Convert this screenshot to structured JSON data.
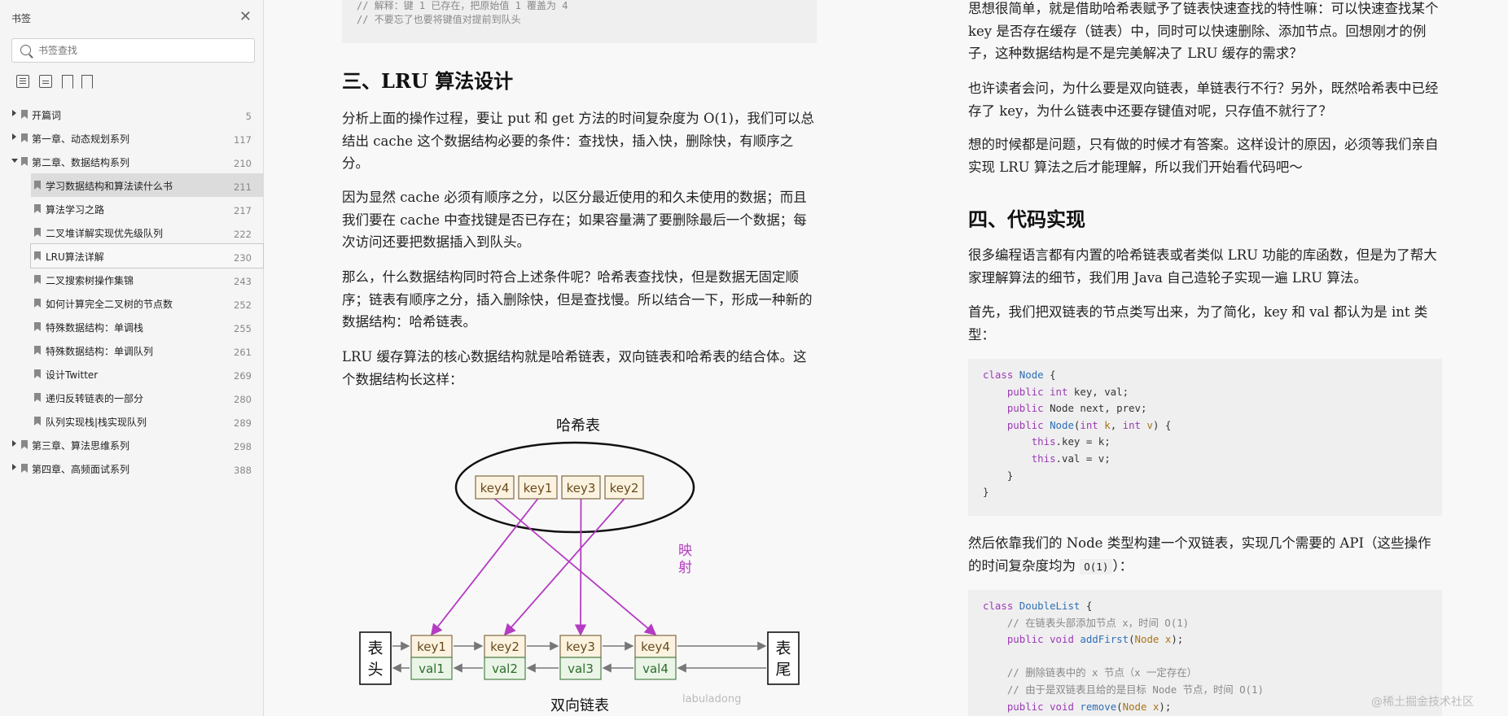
{
  "sidebar": {
    "title": "书签",
    "search_placeholder": "书签查找",
    "items": [
      {
        "label": "开篇词",
        "page": "5",
        "level": 1,
        "toggle": "closed"
      },
      {
        "label": "第一章、动态规划系列",
        "page": "117",
        "level": 1,
        "toggle": "closed"
      },
      {
        "label": "第二章、数据结构系列",
        "page": "210",
        "level": 1,
        "toggle": "open"
      },
      {
        "label": "学习数据结构和算法读什么书",
        "page": "211",
        "level": 2,
        "state": "selected"
      },
      {
        "label": "算法学习之路",
        "page": "217",
        "level": 2
      },
      {
        "label": "二叉堆详解实现优先级队列",
        "page": "222",
        "level": 2
      },
      {
        "label": "LRU算法详解",
        "page": "230",
        "level": 2,
        "state": "current"
      },
      {
        "label": "二叉搜索树操作集锦",
        "page": "243",
        "level": 2
      },
      {
        "label": "如何计算完全二叉树的节点数",
        "page": "252",
        "level": 2
      },
      {
        "label": "特殊数据结构：单调栈",
        "page": "255",
        "level": 2
      },
      {
        "label": "特殊数据结构：单调队列",
        "page": "261",
        "level": 2
      },
      {
        "label": "设计Twitter",
        "page": "269",
        "level": 2
      },
      {
        "label": "递归反转链表的一部分",
        "page": "280",
        "level": 2
      },
      {
        "label": "队列实现栈|栈实现队列",
        "page": "289",
        "level": 2
      },
      {
        "label": "第三章、算法思维系列",
        "page": "298",
        "level": 1,
        "toggle": "closed"
      },
      {
        "label": "第四章、高频面试系列",
        "page": "388",
        "level": 1,
        "toggle": "closed"
      }
    ]
  },
  "left": {
    "code_top": [
      "// 解释：键 1 已存在，把原始值 1 覆盖为 4",
      "// 不要忘了也要将键值对提前到队头"
    ],
    "heading3": "三、LRU 算法设计",
    "p1": "分析上面的操作过程，要让 put 和 get 方法的时间复杂度为 O(1)，我们可以总结出 cache 这个数据结构必要的条件：查找快，插入快，删除快，有顺序之分。",
    "p2": "因为显然 cache 必须有顺序之分，以区分最近使用的和久未使用的数据；而且我们要在 cache 中查找键是否已存在；如果容量满了要删除最后一个数据；每次访问还要把数据插入到队头。",
    "p3": "那么，什么数据结构同时符合上述条件呢？哈希表查找快，但是数据无固定顺序；链表有顺序之分，插入删除快，但是查找慢。所以结合一下，形成一种新的数据结构：哈希链表。",
    "p4": "LRU 缓存算法的核心数据结构就是哈希链表，双向链表和哈希表的结合体。这个数据结构长这样："
  },
  "diagram": {
    "hash_title": "哈希表",
    "hash_keys": [
      "key4",
      "key1",
      "key3",
      "key2"
    ],
    "map_label_1": "映",
    "map_label_2": "射",
    "head_1": "表",
    "head_2": "头",
    "tail_1": "表",
    "tail_2": "尾",
    "list_keys": [
      "key1",
      "key2",
      "key3",
      "key4"
    ],
    "list_vals": [
      "val1",
      "val2",
      "val3",
      "val4"
    ],
    "list_title": "双向链表",
    "credit": "labuladong"
  },
  "right": {
    "p1": "思想很简单，就是借助哈希表赋予了链表快速查找的特性嘛：可以快速查找某个 key 是否存在缓存（链表）中，同时可以快速删除、添加节点。回想刚才的例子，这种数据结构是不是完美解决了 LRU 缓存的需求？",
    "p2": "也许读者会问，为什么要是双向链表，单链表行不行？另外，既然哈希表中已经存了 key，为什么链表中还要存键值对呢，只存值不就行了？",
    "p3": "想的时候都是问题，只有做的时候才有答案。这样设计的原因，必须等我们亲自实现 LRU 算法之后才能理解，所以我们开始看代码吧～",
    "heading4": "四、代码实现",
    "p4": "很多编程语言都有内置的哈希链表或者类似 LRU 功能的库函数，但是为了帮大家理解算法的细节，我们用 Java 自己造轮子实现一遍 LRU 算法。",
    "p5": "首先，我们把双链表的节点类写出来，为了简化，key 和 val 都认为是 int 类型：",
    "p6_a": "然后依靠我们的 Node 类型构建一个双链表，实现几个需要的 API（这些操作的时间复杂度均为 ",
    "p6_code": "O(1)",
    "p6_b": "）："
  },
  "watermark": "@稀土掘金技术社区"
}
